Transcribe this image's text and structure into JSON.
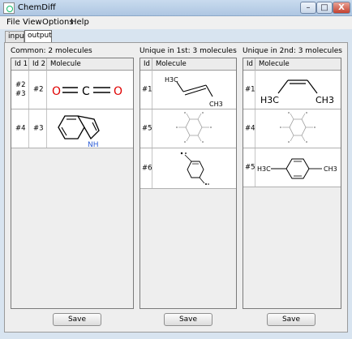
{
  "window": {
    "title": "ChemDiff",
    "min_glyph": "–",
    "max_glyph": "□",
    "close_glyph": "X"
  },
  "menu": {
    "items": [
      "File",
      "View",
      "Options",
      "Help"
    ]
  },
  "tabs": [
    {
      "label": "input",
      "active": false
    },
    {
      "label": "output",
      "active": true
    }
  ],
  "panels": {
    "common": {
      "title": "Common: 2 molecules",
      "headers": [
        "Id 1",
        "Id 2",
        "Molecule"
      ],
      "rows": [
        {
          "id1": "#2\n#3",
          "id2": "#2",
          "molecule": "carbon dioxide"
        },
        {
          "id1": "#4",
          "id2": "#3",
          "molecule": "indole"
        }
      ],
      "save_label": "Save"
    },
    "first": {
      "title": "Unique in 1st: 3 molecules",
      "headers": [
        "Id",
        "Molecule"
      ],
      "rows": [
        {
          "id": "#1",
          "molecule": "2-butene (trans)"
        },
        {
          "id": "#5",
          "molecule": "methylated cyclohexane"
        },
        {
          "id": "#6",
          "molecule": "dimethylbenzene"
        }
      ],
      "save_label": "Save"
    },
    "second": {
      "title": "Unique in 2nd: 3 molecules",
      "headers": [
        "Id",
        "Molecule"
      ],
      "rows": [
        {
          "id": "#1",
          "molecule": "2-butene (cis)"
        },
        {
          "id": "#4",
          "molecule": "methylated cyclohexane"
        },
        {
          "id": "#5",
          "molecule": "p-xylene"
        }
      ],
      "save_label": "Save"
    }
  },
  "atoms": {
    "O": "O",
    "C": "C",
    "NH": "NH",
    "H3C": "H3C",
    "CH3": "CH3"
  },
  "colors": {
    "oxygen": "#e00000",
    "nitrogen": "#2a5bd7",
    "bond": "#000000",
    "faint": "#9a9a9a"
  }
}
